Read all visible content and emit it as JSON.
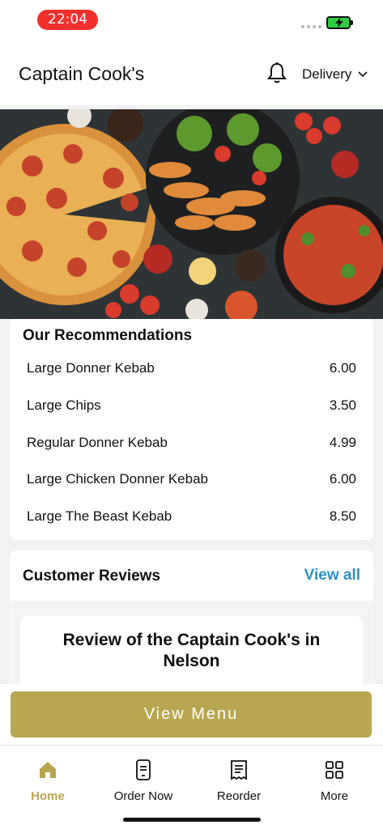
{
  "status_bar": {
    "time": "22:04",
    "battery_icon": "battery-charging-icon"
  },
  "header": {
    "title": "Captain Cook's",
    "bell_icon": "bell-icon",
    "delivery_label": "Delivery",
    "chevron_icon": "chevron-down-icon"
  },
  "recommendations": {
    "title": "Our Recommendations",
    "items": [
      {
        "name": "Large Donner Kebab",
        "price": "6.00"
      },
      {
        "name": "Large Chips",
        "price": "3.50"
      },
      {
        "name": "Regular Donner Kebab",
        "price": "4.99"
      },
      {
        "name": "Large Chicken Donner Kebab",
        "price": "6.00"
      },
      {
        "name": "Large The Beast Kebab",
        "price": "8.50"
      }
    ]
  },
  "reviews": {
    "title": "Customer Reviews",
    "view_all": "View all",
    "review_title": "Review of the Captain Cook's in Nelson"
  },
  "menu_button": "View Menu",
  "tabs": [
    {
      "label": "Home",
      "icon": "home-icon"
    },
    {
      "label": "Order Now",
      "icon": "phone-order-icon"
    },
    {
      "label": "Reorder",
      "icon": "receipt-icon"
    },
    {
      "label": "More",
      "icon": "grid-icon"
    }
  ],
  "colors": {
    "accent": "#b9a650",
    "link": "#2a93c4",
    "time_pill": "#f0302a"
  }
}
